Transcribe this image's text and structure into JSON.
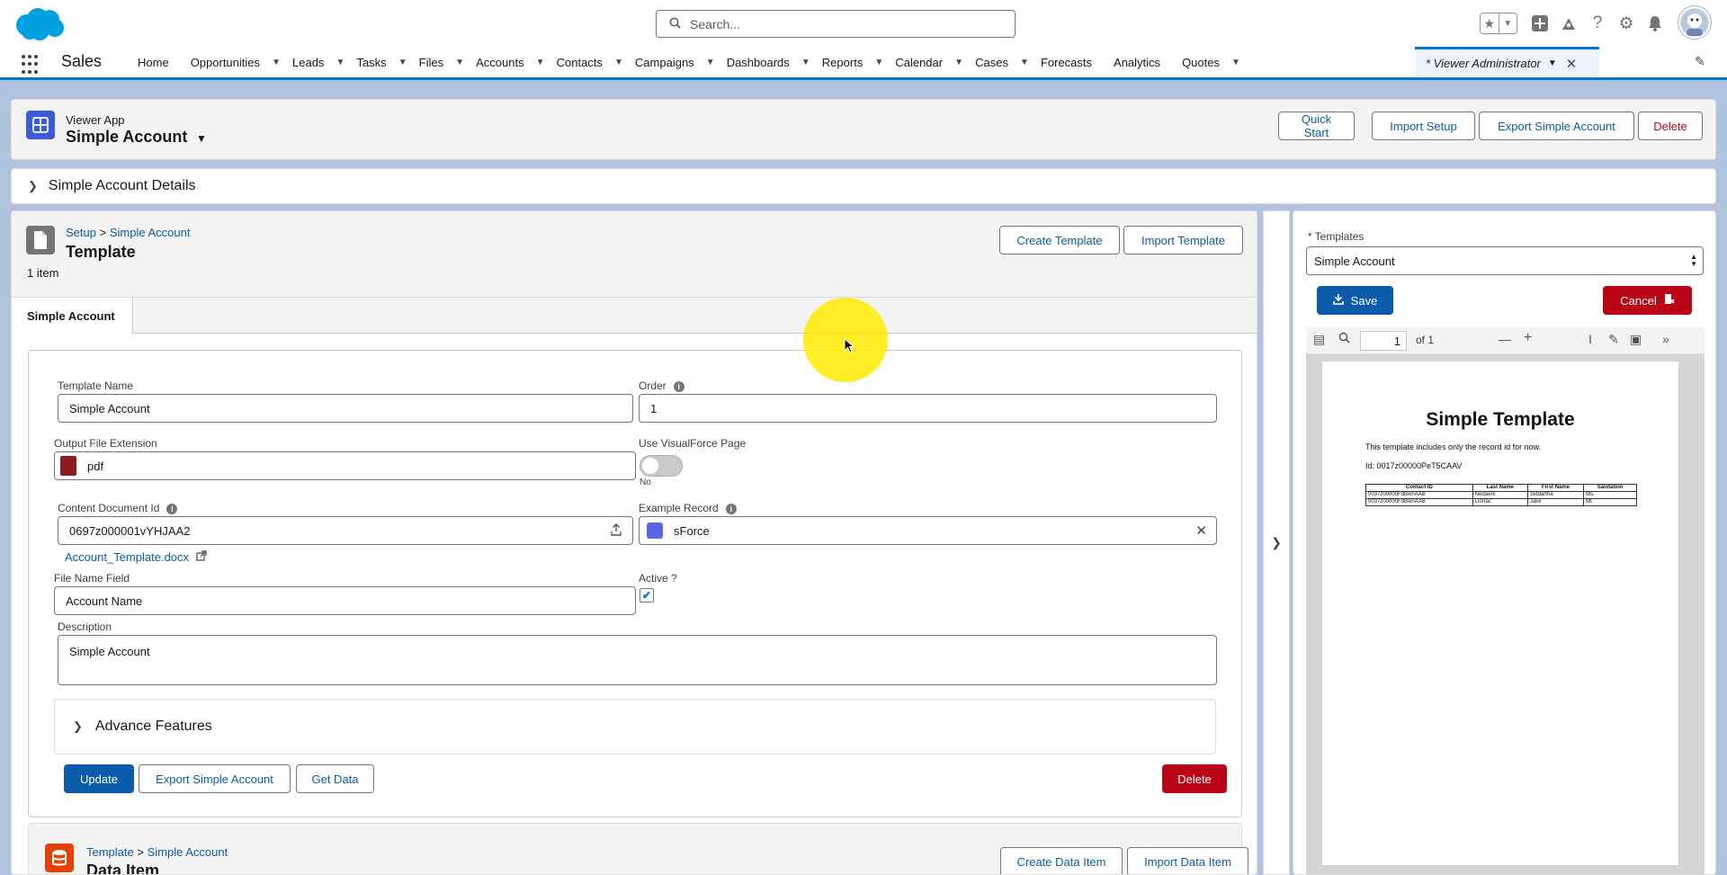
{
  "header": {
    "search_placeholder": "Search..."
  },
  "nav": {
    "app_name": "Sales",
    "items": [
      {
        "label": "Home",
        "chev": false
      },
      {
        "label": "Opportunities",
        "chev": true
      },
      {
        "label": "Leads",
        "chev": true
      },
      {
        "label": "Tasks",
        "chev": true
      },
      {
        "label": "Files",
        "chev": true
      },
      {
        "label": "Accounts",
        "chev": true
      },
      {
        "label": "Contacts",
        "chev": true
      },
      {
        "label": "Campaigns",
        "chev": true
      },
      {
        "label": "Dashboards",
        "chev": true
      },
      {
        "label": "Reports",
        "chev": true
      },
      {
        "label": "Calendar",
        "chev": true
      },
      {
        "label": "Cases",
        "chev": true
      },
      {
        "label": "Forecasts",
        "chev": false
      },
      {
        "label": "Analytics",
        "chev": false
      },
      {
        "label": "Quotes",
        "chev": true
      }
    ],
    "active_tab": "* Viewer Administrator"
  },
  "page_header": {
    "subtitle": "Viewer App",
    "title": "Simple Account",
    "buttons": {
      "quick_start": "Quick Start",
      "import_setup": "Import Setup",
      "export": "Export Simple Account",
      "delete": "Delete"
    }
  },
  "details": {
    "label": "Simple Account Details"
  },
  "template_section": {
    "breadcrumb_setup": "Setup",
    "breadcrumb_sep": ">",
    "breadcrumb_item": "Simple Account",
    "title": "Template",
    "count": "1 item",
    "create_button": "Create Template",
    "import_button": "Import Template",
    "tab": "Simple Account"
  },
  "form": {
    "template_name_label": "Template Name",
    "template_name_value": "Simple Account",
    "order_label": "Order",
    "order_value": "1",
    "output_ext_label": "Output File Extension",
    "output_ext_value": "pdf",
    "use_vf_label": "Use VisualForce Page",
    "use_vf_state": "No",
    "content_doc_label": "Content Document Id",
    "content_doc_value": "0697z000001vYHJAA2",
    "content_doc_link": "Account_Template.docx",
    "example_record_label": "Example Record",
    "example_record_value": "sForce",
    "file_name_field_label": "File Name Field",
    "file_name_field_value": "Account Name",
    "active_label": "Active ?",
    "active_checked": "✔",
    "description_label": "Description",
    "description_value": "Simple Account",
    "advance_features": "Advance Features",
    "update_button": "Update",
    "export_button": "Export Simple Account",
    "get_data_button": "Get Data",
    "delete_button": "Delete"
  },
  "data_item_section": {
    "breadcrumb_template": "Template",
    "breadcrumb_sep": ">",
    "breadcrumb_item": "Simple Account",
    "title": "Data Item",
    "create_button": "Create Data Item",
    "import_button": "Import Data Item"
  },
  "right_panel": {
    "templates_label": "Templates",
    "required_mark": "*",
    "templates_value": "Simple Account",
    "save_button": "Save",
    "cancel_button": "Cancel",
    "page_number": "1",
    "page_of": "of 1"
  },
  "pdf": {
    "title": "Simple Template",
    "description": "This template includes only the record id for now.",
    "id_line": "Id:  0017z00000PeT5CAAV",
    "table_headers": [
      "Contact ID",
      "Last Name",
      "First Name",
      "Salutation"
    ],
    "table_rows": [
      [
        "0037z00000FdBwnAAB",
        "Nedaerk",
        "Siddartha",
        "Ms."
      ],
      [
        "0037z00000FdBwnAAB",
        "Llorrac",
        "Jake",
        "Mr."
      ]
    ]
  },
  "colors": {
    "brand": "#0176d3",
    "brand_dark": "#0b5cab",
    "danger": "#ba0517",
    "salesforce_cloud": "#00a1e0"
  }
}
